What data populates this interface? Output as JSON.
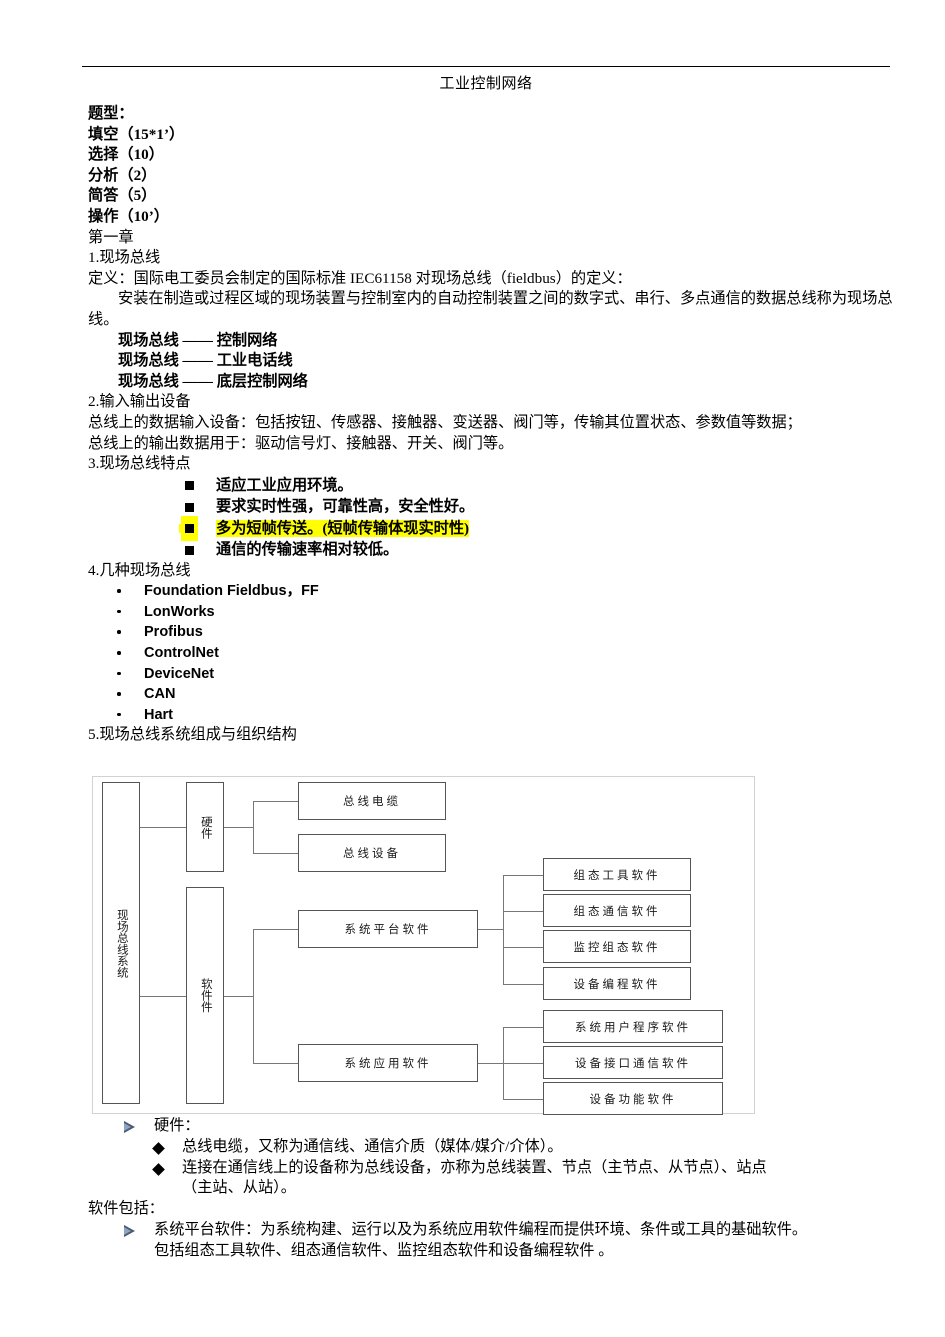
{
  "header": {
    "title": "工业控制网络"
  },
  "intro": {
    "label": "题型：",
    "items": [
      "填空（15*1’）",
      "选择（10）",
      "分析（2）",
      "简答（5）",
      "操作（10’）"
    ],
    "chapter": "第一章"
  },
  "section1": {
    "heading": "1.现场总线",
    "definition_lead": "定义：国际电工委员会制定的国际标准 IEC61158 对现场总线（fieldbus）的定义：",
    "definition_body": "安装在制造或过程区域的现场装置与控制室内的自动控制装置之间的数字式、串行、多点通信的数据总线称为现场总线。",
    "equivalences": [
      "现场总线 —— 控制网络",
      "现场总线 —— 工业电话线",
      "现场总线 —— 底层控制网络"
    ]
  },
  "section2": {
    "heading": "2.输入输出设备",
    "lines": [
      "总线上的数据输入设备：包括按钮、传感器、接触器、变送器、阀门等，传输其位置状态、参数值等数据；",
      "总线上的输出数据用于：驱动信号灯、接触器、开关、阀门等。"
    ]
  },
  "section3": {
    "heading": "3.现场总线特点",
    "features": [
      {
        "text": "适应工业应用环境。",
        "highlight": ""
      },
      {
        "text": "要求实时性强，可靠性高，安全性好。",
        "highlight": ""
      },
      {
        "text": "多为短帧传送。",
        "highlight": "(短帧传输体现实时性)"
      },
      {
        "text": "通信的传输速率相对较低。",
        "highlight": ""
      }
    ]
  },
  "section4": {
    "heading": "4.几种现场总线",
    "buses": [
      "Foundation Fieldbus，FF",
      "LonWorks",
      "Profibus",
      "ControlNet",
      "DeviceNet",
      "CAN",
      "Hart"
    ]
  },
  "section5": {
    "heading": "5.现场总线系统组成与组织结构",
    "diagram": {
      "root": "现场总线系统",
      "hardware": "硬件",
      "software": "软件件",
      "hardware_children": [
        "总线电缆",
        "总线设备"
      ],
      "platform": "系统平台软件",
      "application": "系统应用软件",
      "platform_children": [
        "组态工具软件",
        "组态通信软件",
        "监控组态软件",
        "设备编程软件"
      ],
      "application_children": [
        "系统用户程序软件",
        "设备接口通信软件",
        "设备功能软件"
      ]
    }
  },
  "notes": {
    "hardware_label": "硬件：",
    "hardware_points": [
      {
        "line1": "总线电缆，又称为通信线、通信介质（媒体/媒介/介体）。",
        "line2": ""
      },
      {
        "line1": "连接在通信线上的设备称为总线设备，亦称为总线装置、节点（主节点、从节点）、站点",
        "line2": "（主站、从站）。"
      }
    ],
    "software_label": "软件包括：",
    "software_points": [
      {
        "line1": "系统平台软件：为系统构建、运行以及为系统应用软件编程而提供环境、条件或工具的基础软件。",
        "line2": "包括组态工具软件、组态通信软件、监控组态软件和设备编程软件 。"
      }
    ]
  },
  "colors": {
    "highlight": "#ffff00",
    "text": "#000000",
    "diagram_border": "#555555",
    "diagram_frame": "#d2d2d2"
  }
}
